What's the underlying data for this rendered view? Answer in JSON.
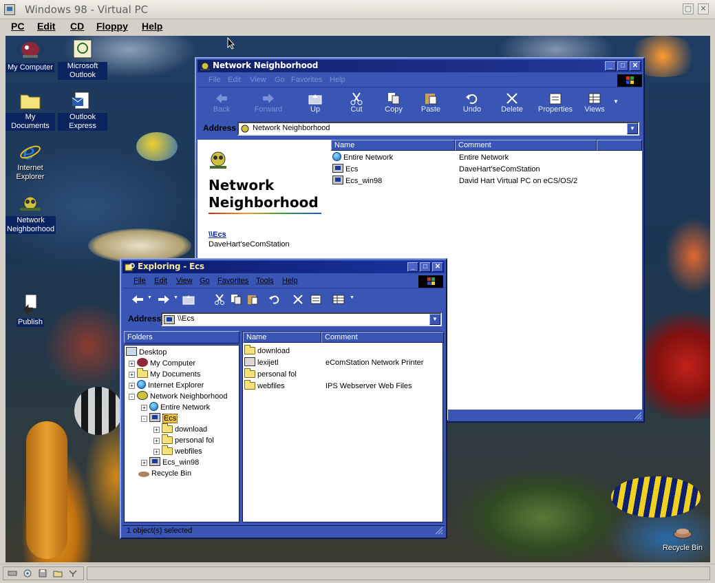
{
  "host": {
    "title": "Windows 98 - Virtual PC",
    "menu": [
      "PC",
      "Edit",
      "CD",
      "Floppy",
      "Help"
    ],
    "controls": [
      "restore",
      "close"
    ]
  },
  "desktop_icons": [
    {
      "label": "My Computer",
      "icon": "my-computer-icon"
    },
    {
      "label": "Microsoft Outlook",
      "icon": "outlook-icon"
    },
    {
      "label": "My Documents",
      "icon": "folder-icon"
    },
    {
      "label": "Outlook Express",
      "icon": "outlook-express-icon"
    },
    {
      "label": "Internet Explorer",
      "icon": "internet-explorer-icon"
    },
    {
      "label": "Network Neighborhood",
      "icon": "network-neighborhood-icon"
    },
    {
      "label": "Publish",
      "icon": "publish-icon"
    },
    {
      "label": "Recycle Bin",
      "icon": "recycle-bin-icon"
    }
  ],
  "network_window": {
    "title": "Network Neighborhood",
    "menu": [
      "File",
      "Edit",
      "View",
      "Go",
      "Favorites",
      "Help"
    ],
    "toolbar": [
      "Back",
      "Forward",
      "Up",
      "Cut",
      "Copy",
      "Paste",
      "Undo",
      "Delete",
      "Properties",
      "Views"
    ],
    "address_label": "Address",
    "address_value": "Network Neighborhood",
    "webview_title_line1": "Network",
    "webview_title_line2": "Neighborhood",
    "selected_link": "\\\\Ecs",
    "selected_desc": "DaveHart'seComStation",
    "columns": [
      "Name",
      "Comment"
    ],
    "items": [
      {
        "name": "Entire Network",
        "comment": "Entire Network",
        "icon": "globe-icon"
      },
      {
        "name": "Ecs",
        "comment": "DaveHart'seComStation",
        "icon": "computer-icon"
      },
      {
        "name": "Ecs_win98",
        "comment": "David Hart Virtual PC on eCS/OS/2",
        "icon": "computer-icon"
      }
    ]
  },
  "explorer_window": {
    "title": "Exploring - Ecs",
    "menu": [
      "File",
      "Edit",
      "View",
      "Go",
      "Favorites",
      "Tools",
      "Help"
    ],
    "address_label": "Address",
    "address_value": "\\\\Ecs",
    "folders_header": "Folders",
    "tree": [
      {
        "label": "Desktop",
        "depth": 0,
        "expander": "",
        "icon": "desktop-icon"
      },
      {
        "label": "My Computer",
        "depth": 1,
        "expander": "+",
        "icon": "my-computer-icon"
      },
      {
        "label": "My Documents",
        "depth": 1,
        "expander": "+",
        "icon": "folder-icon"
      },
      {
        "label": "Internet Explorer",
        "depth": 1,
        "expander": "+",
        "icon": "internet-explorer-icon"
      },
      {
        "label": "Network Neighborhood",
        "depth": 1,
        "expander": "-",
        "icon": "network-neighborhood-icon"
      },
      {
        "label": "Entire Network",
        "depth": 2,
        "expander": "+",
        "icon": "globe-icon"
      },
      {
        "label": "Ecs",
        "depth": 2,
        "expander": "-",
        "icon": "computer-icon",
        "selected": true
      },
      {
        "label": "download",
        "depth": 3,
        "expander": "+",
        "icon": "folder-icon"
      },
      {
        "label": "personal fol",
        "depth": 3,
        "expander": "+",
        "icon": "folder-icon"
      },
      {
        "label": "webfiles",
        "depth": 3,
        "expander": "+",
        "icon": "folder-icon"
      },
      {
        "label": "Ecs_win98",
        "depth": 2,
        "expander": "+",
        "icon": "computer-icon"
      },
      {
        "label": "Recycle Bin",
        "depth": 1,
        "expander": "",
        "icon": "recycle-bin-icon"
      }
    ],
    "columns": [
      "Name",
      "Comment"
    ],
    "items": [
      {
        "name": "download",
        "comment": "",
        "icon": "folder-icon"
      },
      {
        "name": "lexijetl",
        "comment": "eComStation Network Printer",
        "icon": "printer-icon"
      },
      {
        "name": "personal fol",
        "comment": "",
        "icon": "folder-icon"
      },
      {
        "name": "webfiles",
        "comment": "IPS Webserver Web Files",
        "icon": "folder-icon"
      }
    ],
    "status": "1 object(s) selected"
  }
}
